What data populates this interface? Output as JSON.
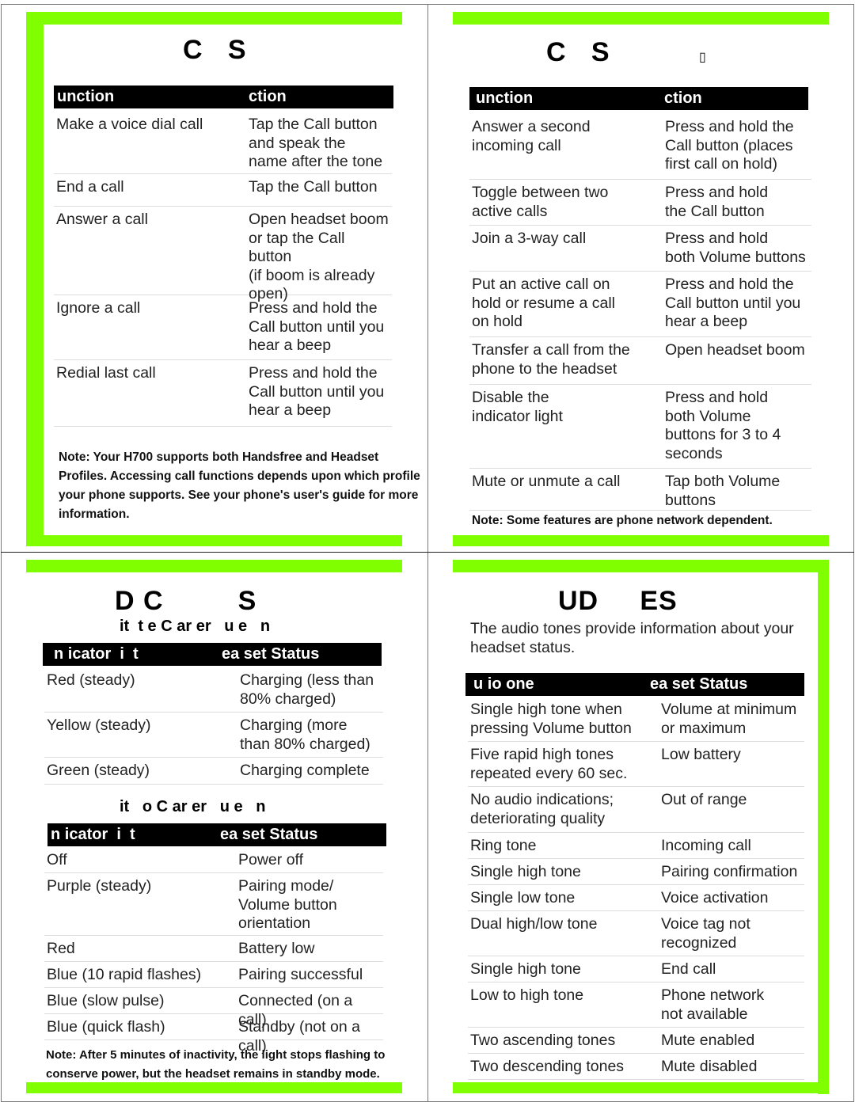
{
  "accent_color": "#80ff00",
  "panel_top_left": {
    "title": "C   S",
    "table": {
      "headers": [
        "unction",
        "ction"
      ],
      "rows": [
        {
          "function": "Make a voice dial call",
          "action": "Tap the Call button\nand speak the\nname after the tone"
        },
        {
          "function": "End a call",
          "action": "Tap the Call button"
        },
        {
          "function": "Answer a call",
          "action": "Open headset boom\nor tap the Call button\n(if boom is already\nopen)"
        },
        {
          "function": "Ignore a call",
          "action": "Press and hold the\nCall button until you\nhear a beep"
        },
        {
          "function": "Redial last call",
          "action": "Press and hold the\nCall button until you\nhear a beep"
        }
      ]
    },
    "note": "Note: Your H700 supports both Handsfree and Headset Profiles. Accessing call functions depends upon which profile your phone supports. See your phone's user's guide for more information."
  },
  "panel_top_right": {
    "title": "C   S",
    "title_glyph": "▯",
    "table": {
      "headers": [
        "unction",
        "ction"
      ],
      "rows": [
        {
          "function": "Answer a second\nincoming call",
          "action": "Press and hold the\nCall button (places\nfirst call on hold)"
        },
        {
          "function": "Toggle between two\nactive calls",
          "action": "Press and hold\nthe Call button"
        },
        {
          "function": "Join a 3-way call",
          "action": "Press and hold\nboth Volume buttons"
        },
        {
          "function": "Put an active call on\nhold or resume a call\non hold",
          "action": "Press and hold the\nCall button until you\nhear a beep"
        },
        {
          "function": "Transfer a call from the\nphone to the headset",
          "action": "Open headset boom"
        },
        {
          "function": "Disable the\nindicator light",
          "action": "Press and hold\nboth Volume\nbuttons for 3 to 4\nseconds"
        },
        {
          "function": "Mute or unmute a call",
          "action": "Tap both Volume\nbuttons"
        }
      ]
    },
    "note": "Note: Some features are phone network dependent."
  },
  "panel_bottom_left": {
    "title": "D C         S",
    "section1": {
      "subtitle": "it  t e C ar er   u e   n",
      "headers": [
        "n icator  i  t",
        "ea set Status"
      ],
      "rows": [
        {
          "indicator": "Red (steady)",
          "status": "Charging (less than\n80% charged)"
        },
        {
          "indicator": "Yellow (steady)",
          "status": "Charging (more\nthan 80% charged)"
        },
        {
          "indicator": "Green (steady)",
          "status": "Charging complete"
        }
      ]
    },
    "section2": {
      "subtitle": "it   o C ar er   u e   n",
      "headers": [
        "n icator  i  t",
        "ea set Status"
      ],
      "rows": [
        {
          "indicator": "Off",
          "status": "Power off"
        },
        {
          "indicator": "Purple (steady)",
          "status": "Pairing mode/\nVolume button\norientation"
        },
        {
          "indicator": "Red",
          "status": "Battery low"
        },
        {
          "indicator": "Blue (10 rapid flashes)",
          "status": "Pairing successful"
        },
        {
          "indicator": "Blue (slow pulse)",
          "status": "Connected (on a call)"
        },
        {
          "indicator": "Blue (quick flash)",
          "status": "Standby (not on a call)"
        }
      ]
    },
    "note": "Note: After 5 minutes of inactivity, the light stops flashing to conserve power, but the headset remains in standby mode."
  },
  "panel_bottom_right": {
    "title": "UD     ES",
    "intro": "The audio tones provide information about your headset status.",
    "table": {
      "headers": [
        "u io one",
        "ea set Status"
      ],
      "rows": [
        {
          "tone": "Single high tone when\npressing Volume button",
          "status": "Volume at minimum\nor maximum"
        },
        {
          "tone": "Five rapid high tones\nrepeated every 60 sec.",
          "status": "Low battery"
        },
        {
          "tone": "No audio indications;\ndeteriorating quality",
          "status": "Out of range"
        },
        {
          "tone": "Ring tone",
          "status": "Incoming call"
        },
        {
          "tone": "Single high tone",
          "status": "Pairing confirmation"
        },
        {
          "tone": "Single low tone",
          "status": "Voice activation"
        },
        {
          "tone": "Dual high/low tone",
          "status": "Voice tag not\nrecognized"
        },
        {
          "tone": "Single high tone",
          "status": "End call"
        },
        {
          "tone": "Low to high tone",
          "status": "Phone network\nnot available"
        },
        {
          "tone": "Two ascending tones",
          "status": "Mute enabled"
        },
        {
          "tone": "Two descending tones",
          "status": "Mute disabled"
        }
      ]
    }
  }
}
